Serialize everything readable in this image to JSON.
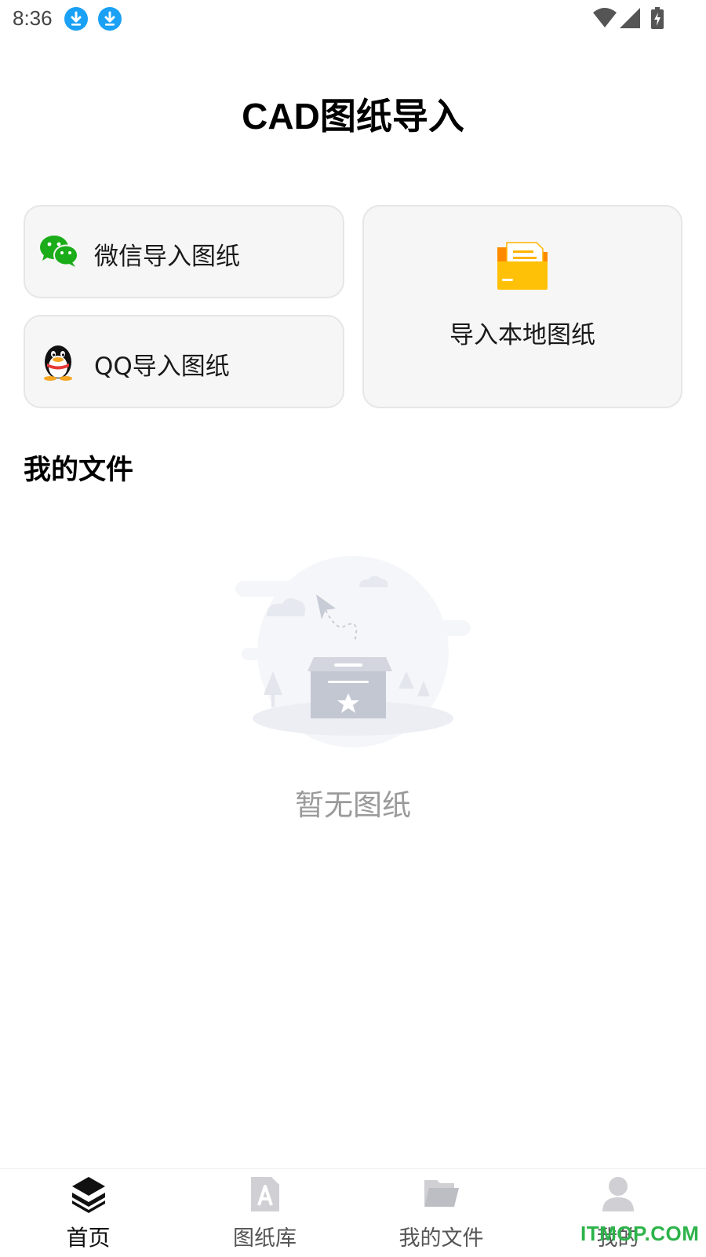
{
  "status_bar": {
    "time": "8:36",
    "icons": [
      "download-icon",
      "download-icon",
      "wifi-icon",
      "cell-signal-icon",
      "battery-charging-icon"
    ]
  },
  "header": {
    "title": "CAD图纸导入"
  },
  "import_options": {
    "wechat": {
      "label": "微信导入图纸",
      "icon": "wechat-icon"
    },
    "qq": {
      "label": "QQ导入图纸",
      "icon": "qq-penguin-icon"
    },
    "local": {
      "label": "导入本地图纸",
      "icon": "folder-icon"
    }
  },
  "my_files": {
    "title": "我的文件",
    "empty_text": "暂无图纸"
  },
  "bottom_nav": {
    "items": [
      {
        "label": "首页",
        "icon": "layers-icon",
        "active": true
      },
      {
        "label": "图纸库",
        "icon": "document-a-icon",
        "active": false
      },
      {
        "label": "我的文件",
        "icon": "folder-open-icon",
        "active": false
      },
      {
        "label": "我的",
        "icon": "user-icon",
        "active": false
      }
    ]
  },
  "watermark": "ITMOP.COM",
  "colors": {
    "accent_blue": "#1AA0F5",
    "wechat_green": "#1AAD19",
    "folder_orange": "#FFB300",
    "watermark_green": "#2DB34A"
  }
}
